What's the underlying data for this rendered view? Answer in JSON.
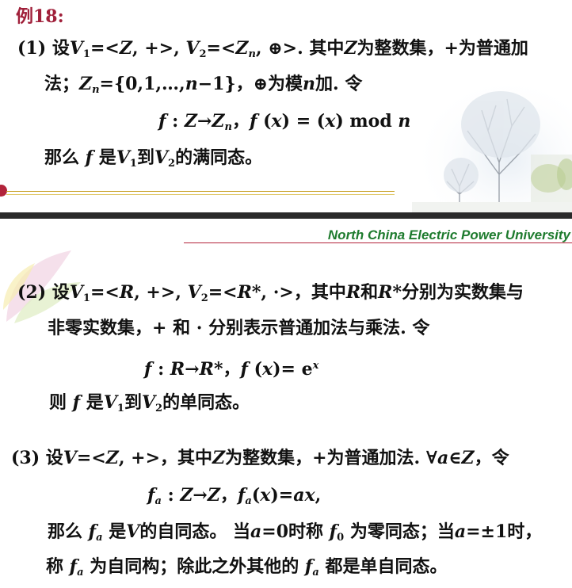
{
  "example_title": "例18:",
  "part1": {
    "num": "(1)",
    "line1": {
      "a": "设",
      "V1": "V",
      "s1": "1",
      "b": "=<",
      "Z": "Z",
      "c": ", +>, ",
      "V2": "V",
      "s2": "2",
      "d": "=<",
      "Zn": "Z",
      "sn": "n",
      "e": ", ⊕>.  其中",
      "Z2": "Z",
      "f": "为整数集，+为普通加"
    },
    "line2": {
      "a": "法；",
      "Zn": "Z",
      "sn": "n",
      "b": "={0,1,…,",
      "n": "n",
      "c": "−1}，⊕为模",
      "n2": "n",
      "d": "加. 令"
    },
    "formula": {
      "f": "f",
      "a": " : ",
      "Z": "Z",
      "arrow": "→",
      "Zn": "Z",
      "sn": "n",
      "b": "，",
      "f2": "f",
      "c": " (",
      "x": "x",
      "d": ") = (",
      "x2": "x",
      "e": ") mod ",
      "n": "n"
    },
    "conclusion": {
      "a": "那么 ",
      "f": "f",
      "b": " 是",
      "V1": "V",
      "s1": "1",
      "c": "到",
      "V2": "V",
      "s2": "2",
      "d": "的满同态。"
    }
  },
  "university": "North China Electric Power University",
  "part2": {
    "num": "(2)",
    "line1": {
      "a": " 设",
      "V1": "V",
      "s1": "1",
      "b": "=<",
      "R": "R",
      "c": ", +>, ",
      "V2": "V",
      "s2": "2",
      "d": "=<",
      "Rs": "R",
      "e": "*, ·>，其中",
      "R2": "R",
      "f": "和",
      "R3": "R",
      "g": "*分别为实数集与"
    },
    "line2": "非零实数集，+ 和 · 分别表示普通加法与乘法. 令",
    "formula": {
      "f": "f",
      "a": " : ",
      "R": "R",
      "arrow": "→",
      "Rs": "R",
      "b": "*，",
      "f2": "f",
      "c": " (",
      "x": "x",
      "d": ")= e",
      "ex": "x"
    },
    "conclusion": {
      "a": "则 ",
      "f": "f",
      "b": " 是",
      "V1": "V",
      "s1": "1",
      "c": "到",
      "V2": "V",
      "s2": "2",
      "d": "的单同态。"
    }
  },
  "part3": {
    "num": "(3)",
    "line1": {
      "a": " 设",
      "V": "V",
      "b": "=<",
      "Z": "Z",
      "c": ", +>，其中",
      "Z2": "Z",
      "d": "为整数集，+为普通加法. ∀",
      "a_var": "a",
      "e": "∈",
      "Z3": "Z",
      "f": "，令"
    },
    "formula": {
      "f": "f",
      "sa": "a",
      "a": " : ",
      "Z": "Z",
      "arrow": "→",
      "Z2": "Z",
      "b": "，",
      "f2": "f",
      "sa2": "a",
      "c": "(",
      "x": "x",
      "d": ")=",
      "ax": "ax",
      "e": ","
    },
    "line3": {
      "a": "那么 ",
      "f": "f",
      "sa": "a",
      "b": " 是",
      "V": "V",
      "c": "的自同态。 当",
      "a_var": "a",
      "d": "=0时称 ",
      "f0": "f",
      "s0": "0",
      "e": " 为零同态；当",
      "a_var2": "a",
      "g": "=±1时，"
    },
    "line4": {
      "a": "称 ",
      "f": "f",
      "sa": "a",
      "b": " 为自同构；除此之外其他的 ",
      "f2": "f",
      "sa2": "a",
      "c": " 都是单自同态。"
    }
  },
  "colors": {
    "title": "#a0203a",
    "university": "#1e7b2e",
    "band": "#2a2a2a",
    "rule": "#c9a227"
  }
}
